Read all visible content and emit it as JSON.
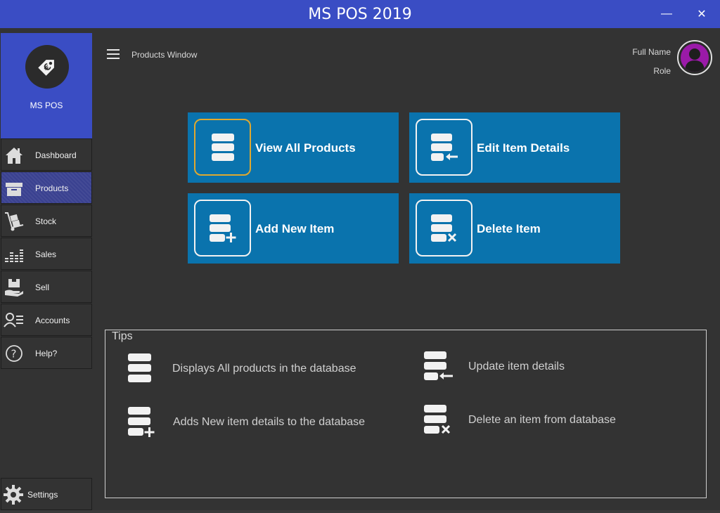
{
  "window": {
    "title": "MS POS 2019",
    "minimize_glyph": "—",
    "close_glyph": "✕"
  },
  "brand": {
    "name": "MS POS",
    "icon": "price-tag-euro-icon"
  },
  "nav": {
    "items": [
      {
        "label": "Dashboard",
        "icon": "home-icon"
      },
      {
        "label": "Products",
        "icon": "box-icon",
        "active": true
      },
      {
        "label": "Stock",
        "icon": "hand-truck-icon"
      },
      {
        "label": "Sales",
        "icon": "bar-chart-icon"
      },
      {
        "label": "Sell",
        "icon": "hand-box-icon"
      },
      {
        "label": "Accounts",
        "icon": "user-list-icon"
      },
      {
        "label": "Help?",
        "icon": "question-icon"
      }
    ],
    "settings": {
      "label": "Settings",
      "icon": "gear-icon"
    }
  },
  "header": {
    "page_title": "Products Window",
    "user_name": "Full Name",
    "user_role": "Role"
  },
  "tiles": [
    {
      "label": "View All Products",
      "icon": "database-list-icon",
      "focused": true
    },
    {
      "label": "Edit Item Details",
      "icon": "database-edit-icon"
    },
    {
      "label": "Add New Item",
      "icon": "database-add-icon"
    },
    {
      "label": "Delete Item",
      "icon": "database-delete-icon"
    }
  ],
  "tips": {
    "title": "Tips",
    "items": [
      {
        "text": "Displays All products in the database",
        "icon": "database-list-icon"
      },
      {
        "text": "Update item details",
        "icon": "database-edit-icon"
      },
      {
        "text": "Adds New item details to the database",
        "icon": "database-add-icon"
      },
      {
        "text": "Delete an item from database",
        "icon": "database-delete-icon"
      }
    ]
  },
  "colors": {
    "accent": "#3a4dc4",
    "tile": "#0a73ad",
    "background": "#333333",
    "focus": "#e0a82e",
    "avatar": "#9a1aa8"
  }
}
